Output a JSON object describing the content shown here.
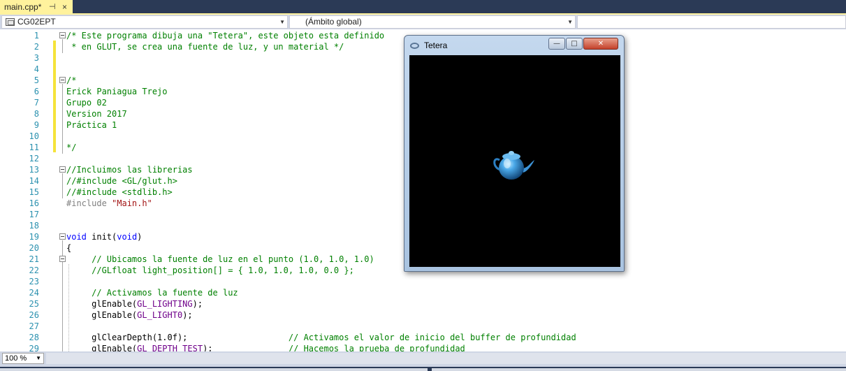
{
  "tab": {
    "title": "main.cpp*",
    "pin": "⊣",
    "close": "×"
  },
  "nav": {
    "project": "CG02EPT",
    "scope": "(Ámbito global)",
    "member": ""
  },
  "editor": {
    "lines": [
      {
        "n": "1",
        "segs": [
          {
            "c": "cm",
            "t": "/* Este programa dibuja una \"Tetera\", este objeto esta definido"
          }
        ]
      },
      {
        "n": "2",
        "segs": [
          {
            "c": "cm",
            "t": " * en GLUT, se crea una fuente de luz, y un material */"
          }
        ]
      },
      {
        "n": "3",
        "segs": []
      },
      {
        "n": "4",
        "segs": []
      },
      {
        "n": "5",
        "segs": [
          {
            "c": "cm",
            "t": "/*"
          }
        ]
      },
      {
        "n": "6",
        "segs": [
          {
            "c": "cm",
            "t": "Erick Paniagua Trejo"
          }
        ]
      },
      {
        "n": "7",
        "segs": [
          {
            "c": "cm",
            "t": "Grupo 02"
          }
        ]
      },
      {
        "n": "8",
        "segs": [
          {
            "c": "cm",
            "t": "Version 2017"
          }
        ]
      },
      {
        "n": "9",
        "segs": [
          {
            "c": "cm",
            "t": "Práctica 1"
          }
        ]
      },
      {
        "n": "10",
        "segs": []
      },
      {
        "n": "11",
        "segs": [
          {
            "c": "cm",
            "t": "*/"
          }
        ]
      },
      {
        "n": "12",
        "segs": []
      },
      {
        "n": "13",
        "segs": [
          {
            "c": "cm",
            "t": "//Incluimos las librerias"
          }
        ]
      },
      {
        "n": "14",
        "segs": [
          {
            "c": "cm",
            "t": "//#include <GL/glut.h>"
          }
        ]
      },
      {
        "n": "15",
        "segs": [
          {
            "c": "cm",
            "t": "//#include <stdlib.h>"
          }
        ]
      },
      {
        "n": "16",
        "segs": [
          {
            "c": "pp",
            "t": "#include "
          },
          {
            "c": "st",
            "t": "\"Main.h\""
          }
        ]
      },
      {
        "n": "17",
        "segs": []
      },
      {
        "n": "18",
        "segs": []
      },
      {
        "n": "19",
        "segs": [
          {
            "c": "kw",
            "t": "void"
          },
          {
            "c": "",
            "t": " init("
          },
          {
            "c": "kw",
            "t": "void"
          },
          {
            "c": "",
            "t": ")"
          }
        ]
      },
      {
        "n": "20",
        "segs": [
          {
            "c": "",
            "t": "{"
          }
        ]
      },
      {
        "n": "21",
        "segs": [
          {
            "c": "cm",
            "t": "     // Ubicamos la fuente de luz en el punto (1.0, 1.0, 1.0)"
          }
        ]
      },
      {
        "n": "22",
        "segs": [
          {
            "c": "cm",
            "t": "     //GLfloat light_position[] = { 1.0, 1.0, 1.0, 0.0 };"
          }
        ]
      },
      {
        "n": "23",
        "segs": []
      },
      {
        "n": "24",
        "segs": [
          {
            "c": "cm",
            "t": "     // Activamos la fuente de luz"
          }
        ]
      },
      {
        "n": "25",
        "segs": [
          {
            "c": "",
            "t": "     glEnable("
          },
          {
            "c": "mc",
            "t": "GL_LIGHTING"
          },
          {
            "c": "",
            "t": ");"
          }
        ]
      },
      {
        "n": "26",
        "segs": [
          {
            "c": "",
            "t": "     glEnable("
          },
          {
            "c": "mc",
            "t": "GL_LIGHT0"
          },
          {
            "c": "",
            "t": ");"
          }
        ]
      },
      {
        "n": "27",
        "segs": []
      },
      {
        "n": "28",
        "segs": [
          {
            "c": "",
            "t": "     glClearDepth(1.0f);                    "
          },
          {
            "c": "cm",
            "t": "// Activamos el valor de inicio del buffer de profundidad"
          }
        ]
      },
      {
        "n": "29",
        "segs": [
          {
            "c": "",
            "t": "     glEnable("
          },
          {
            "c": "mc",
            "t": "GL_DEPTH_TEST"
          },
          {
            "c": "",
            "t": ");               "
          },
          {
            "c": "cm",
            "t": "// Hacemos la prueba de profundidad"
          }
        ]
      }
    ]
  },
  "status": {
    "zoom": "100 %"
  },
  "glwindow": {
    "title": "Tetera",
    "min": "—",
    "max": "□",
    "close": "✕"
  },
  "colors": {
    "comment": "#008000",
    "keyword": "#0000ff",
    "string": "#a31515",
    "macro": "#6f008a",
    "linenum": "#2b91af",
    "tab": "#fff29d",
    "chrome": "#2b3a56"
  }
}
